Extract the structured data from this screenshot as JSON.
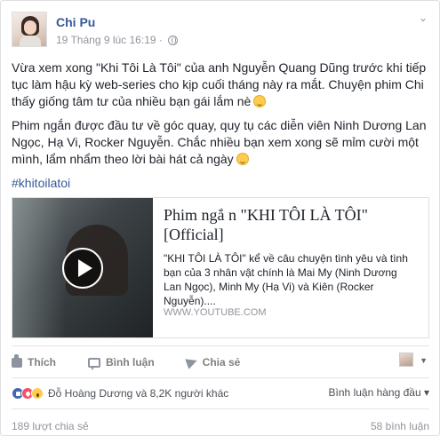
{
  "post": {
    "author": "Chi Pu",
    "timestamp": "19 Tháng 9 lúc 16:19 ·",
    "privacy_icon": "globe-icon",
    "paragraph1": "Vừa xem xong \"Khi Tôi Là Tôi\" của anh Nguyễn Quang Dũng trước khi tiếp tục làm hậu kỳ web-series cho kịp cuối tháng này ra mắt. Chuyện phim Chi thấy giống tâm tư của nhiều bạn gái lắm nè",
    "paragraph2": "Phim ngắn được đầu tư về góc quay, quy tụ các diễn viên Ninh Dương Lan Ngọc, Hạ Vi, Rocker Nguyễn. Chắc nhiều bạn xem xong sẽ mỉm cười một mình, lẩm nhẩm theo lời bài hát cả ngày",
    "hashtag": "#khitoilatoi"
  },
  "link": {
    "title": "Phim ngắ n \"KHI TÔI LÀ TÔI\" [Official]",
    "description": "\"KHI TÔI LÀ TÔI\" kể về câu chuyện tình yêu và tình bạn của 3 nhân vật chính là Mai My (Ninh Dương Lan Ngọc), Minh My (Hạ Vi) và Kiên (Rocker Nguyễn)....",
    "domain": "WWW.YOUTUBE.COM"
  },
  "actions": {
    "like": "Thích",
    "comment": "Bình luận",
    "share": "Chia sẻ"
  },
  "reactions": {
    "names": "Đỗ Hoàng Dương và 8,2K người khác",
    "sort_label": "Bình luận hàng đầu ▾"
  },
  "footer": {
    "shares": "189 lượt chia sẻ",
    "comments": "58 bình luận"
  }
}
